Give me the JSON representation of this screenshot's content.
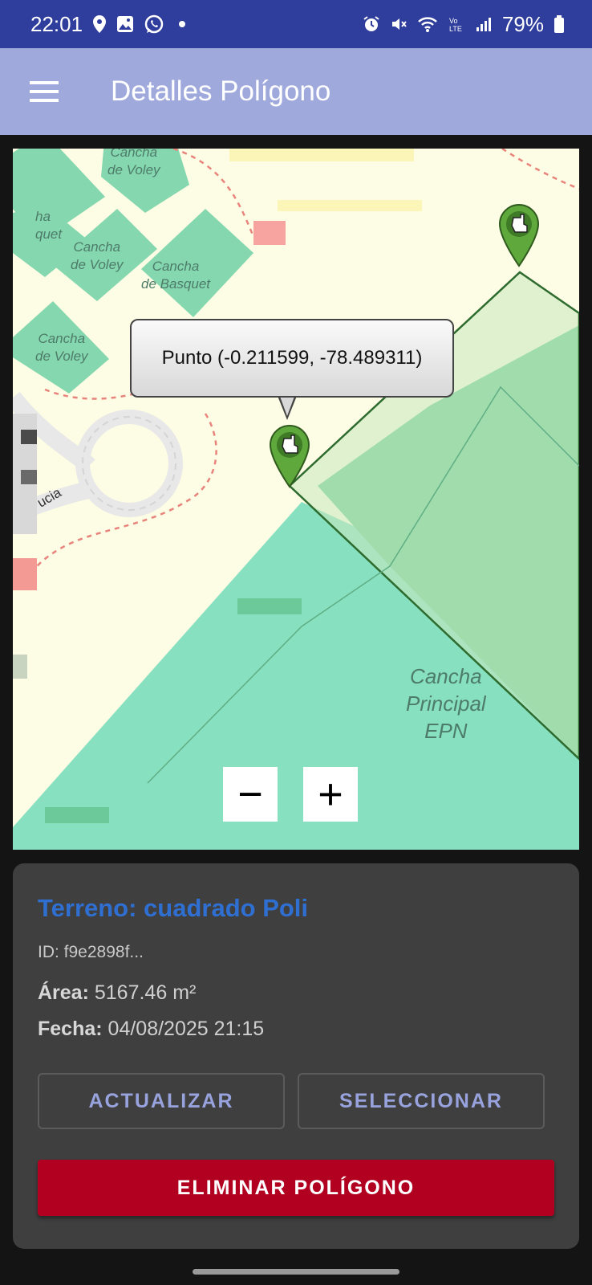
{
  "status_bar": {
    "time": "22:01",
    "battery": "79%",
    "icons": [
      "location-icon",
      "image-icon",
      "whatsapp-icon",
      "alarm-icon",
      "mute-icon",
      "wifi-icon",
      "volte-icon",
      "signal-icon",
      "battery-icon"
    ]
  },
  "app_bar": {
    "title": "Detalles Polígono",
    "menu_icon": "menu-icon"
  },
  "map": {
    "tooltip": "Punto (-0.211599, -78.489311)",
    "labels": {
      "voley_top": "Cancha\nde Voley",
      "voley_mid": "Cancha\nde Voley",
      "basquet": "Cancha\nde Basquet",
      "voley_left": "Cancha\nde Voley",
      "basquet_left": "ha\nquet",
      "street": "ucia",
      "principal": "Cancha\nPrincipal\nEPN"
    },
    "zoom_out_label": "−",
    "zoom_in_label": "+",
    "colors": {
      "polygon_fill": "#c9e8c0",
      "polygon_stroke": "#2e6b2e",
      "field_green": "#79d3a0",
      "marker_green": "#5ea83c"
    }
  },
  "details": {
    "title": "Terreno: cuadrado Poli",
    "id_text": "ID: f9e2898f...",
    "area_label": "Área:",
    "area_value": "5167.46 m²",
    "date_label": "Fecha:",
    "date_value": "04/08/2025 21:15",
    "update_button": "ACTUALIZAR",
    "select_button": "SELECCIONAR",
    "delete_button": "ELIMINAR POLÍGONO"
  }
}
